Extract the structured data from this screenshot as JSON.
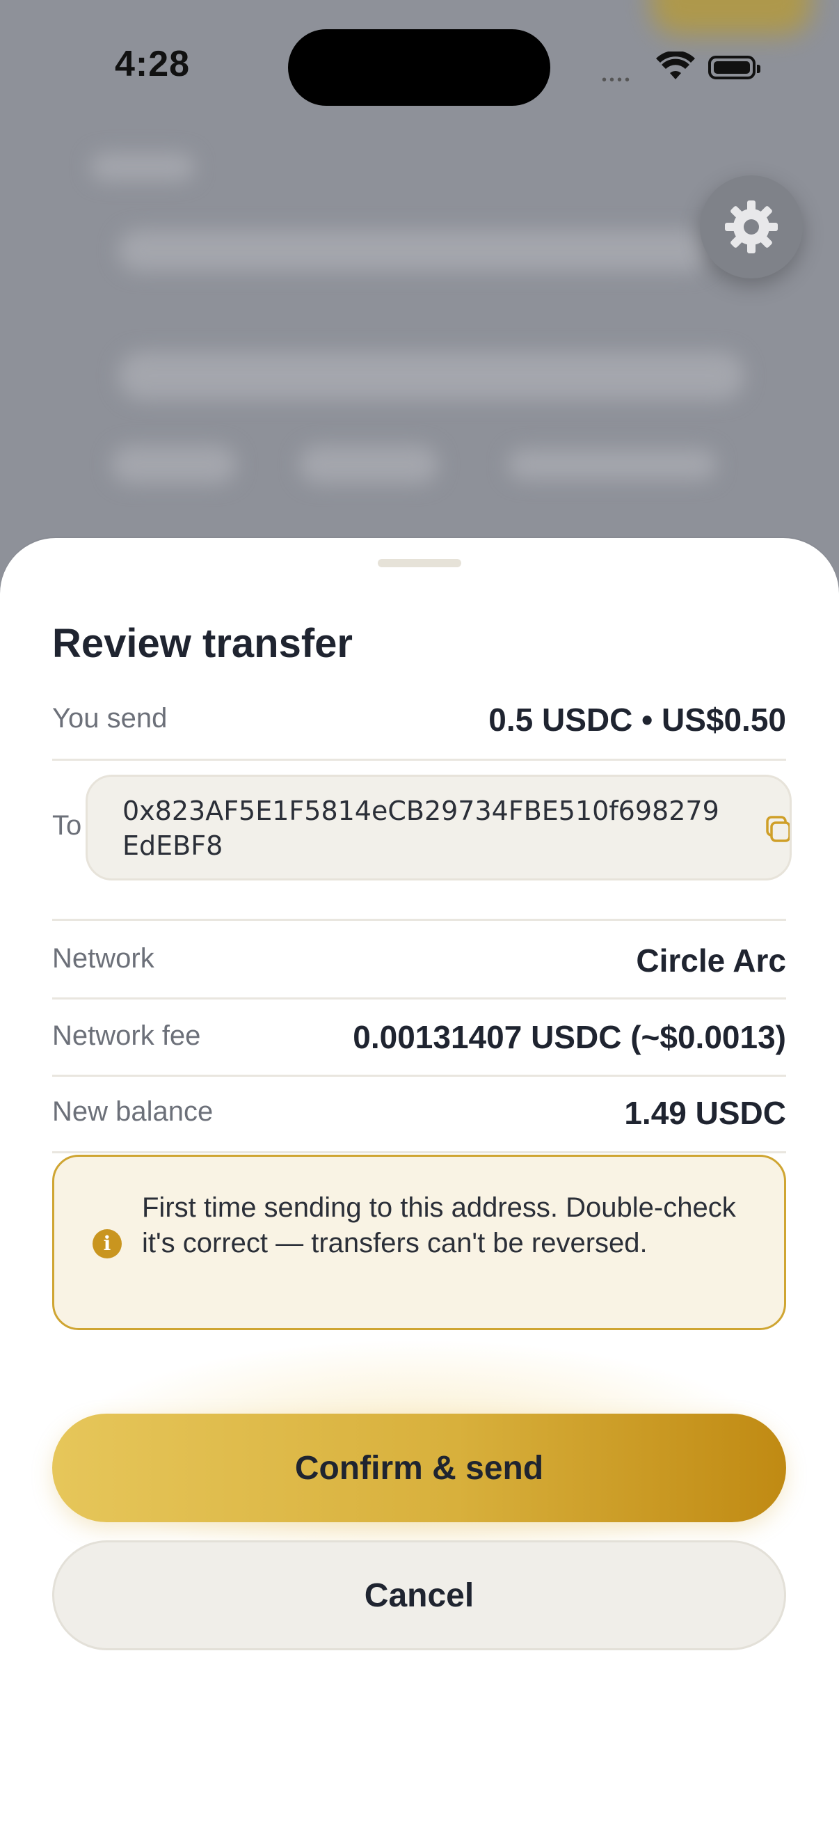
{
  "status_bar": {
    "time": "4:28"
  },
  "sheet": {
    "title": "Review transfer",
    "rows": {
      "you_send": {
        "label": "You send",
        "value": "0.5 USDC • US$0.50"
      },
      "to": {
        "label": "To",
        "address": "0x823AF5E1F5814eCB29734FBE510f698279EdEBF8"
      },
      "network": {
        "label": "Network",
        "value": "Circle Arc"
      },
      "fee": {
        "label": "Network fee",
        "value": "0.00131407 USDC (~$0.0013)"
      },
      "balance": {
        "label": "New balance",
        "value": "1.49 USDC"
      }
    },
    "warning": "First time sending to this address. Double-check it's correct — transfers can't be reversed.",
    "confirm_label": "Confirm & send",
    "cancel_label": "Cancel"
  },
  "colors": {
    "accent": "#d8b03c",
    "accent_dark": "#c08a13",
    "text": "#1f2430",
    "muted": "#6c7079",
    "warning_bg": "#f9f3e4"
  },
  "icons": [
    "settings-gear-icon",
    "copy-icon",
    "info-icon",
    "wifi-icon",
    "battery-icon",
    "cellular-signal-icon"
  ]
}
